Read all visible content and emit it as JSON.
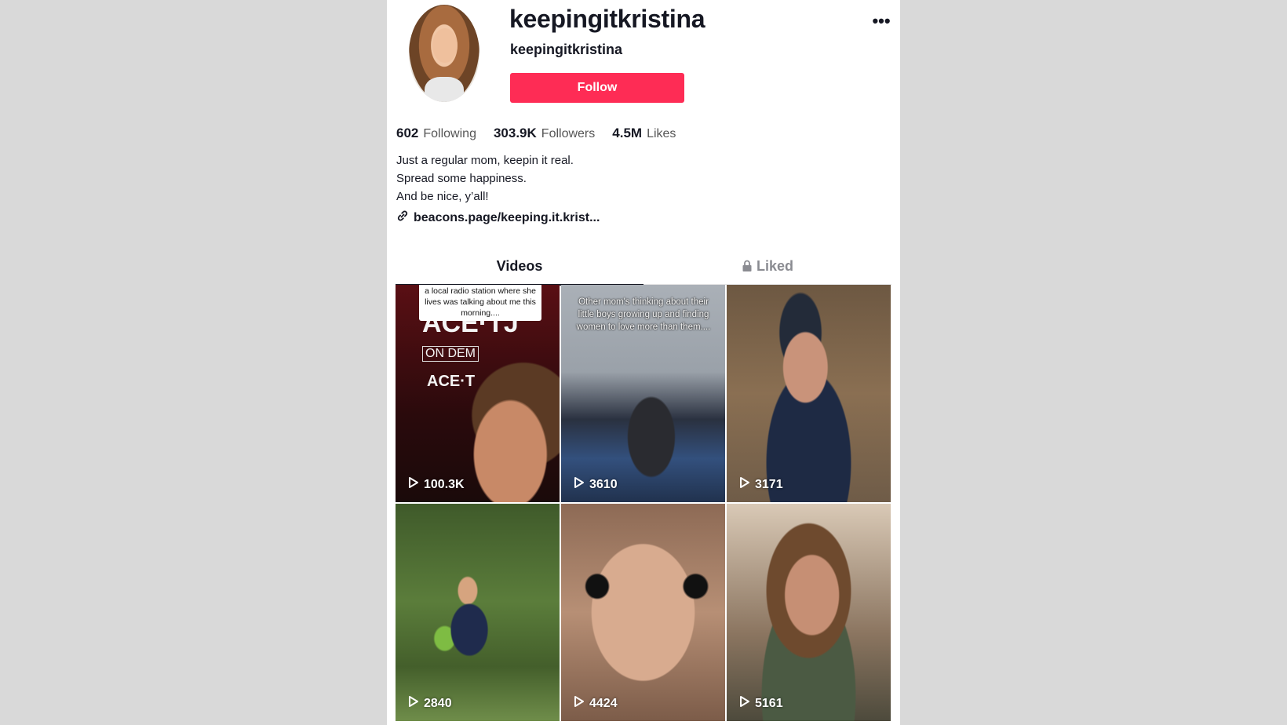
{
  "profile": {
    "display_name": "keepingitkristina",
    "username": "keepingitkristina",
    "follow_label": "Follow",
    "more_icon": "•••"
  },
  "stats": {
    "following_count": "602",
    "following_label": "Following",
    "followers_count": "303.9K",
    "followers_label": "Followers",
    "likes_count": "4.5M",
    "likes_label": "Likes"
  },
  "bio": {
    "line1": "Just a regular mom, keepin it real.",
    "line2": "Spread some happiness.",
    "line3": "And be nice, y’all!"
  },
  "link": {
    "text": "beacons.page/keeping.it.krist..."
  },
  "tabs": {
    "videos": "Videos",
    "liked": "Liked"
  },
  "videos": [
    {
      "views": "100.3K",
      "caption": "a local radio station where she lives was talking about me this morning....",
      "sign_text_1": "ACE·TJ",
      "sign_text_2": "ON DEM",
      "sign_text_3": "ACE·T"
    },
    {
      "views": "3610",
      "caption": "Other mom's thinking about their little boys growing up and finding women to love more than them...."
    },
    {
      "views": "3171"
    },
    {
      "views": "2840"
    },
    {
      "views": "4424"
    },
    {
      "views": "5161"
    }
  ],
  "colors": {
    "follow_button": "#fe2c55",
    "text_primary": "#161823",
    "background": "#d9d9d9"
  }
}
